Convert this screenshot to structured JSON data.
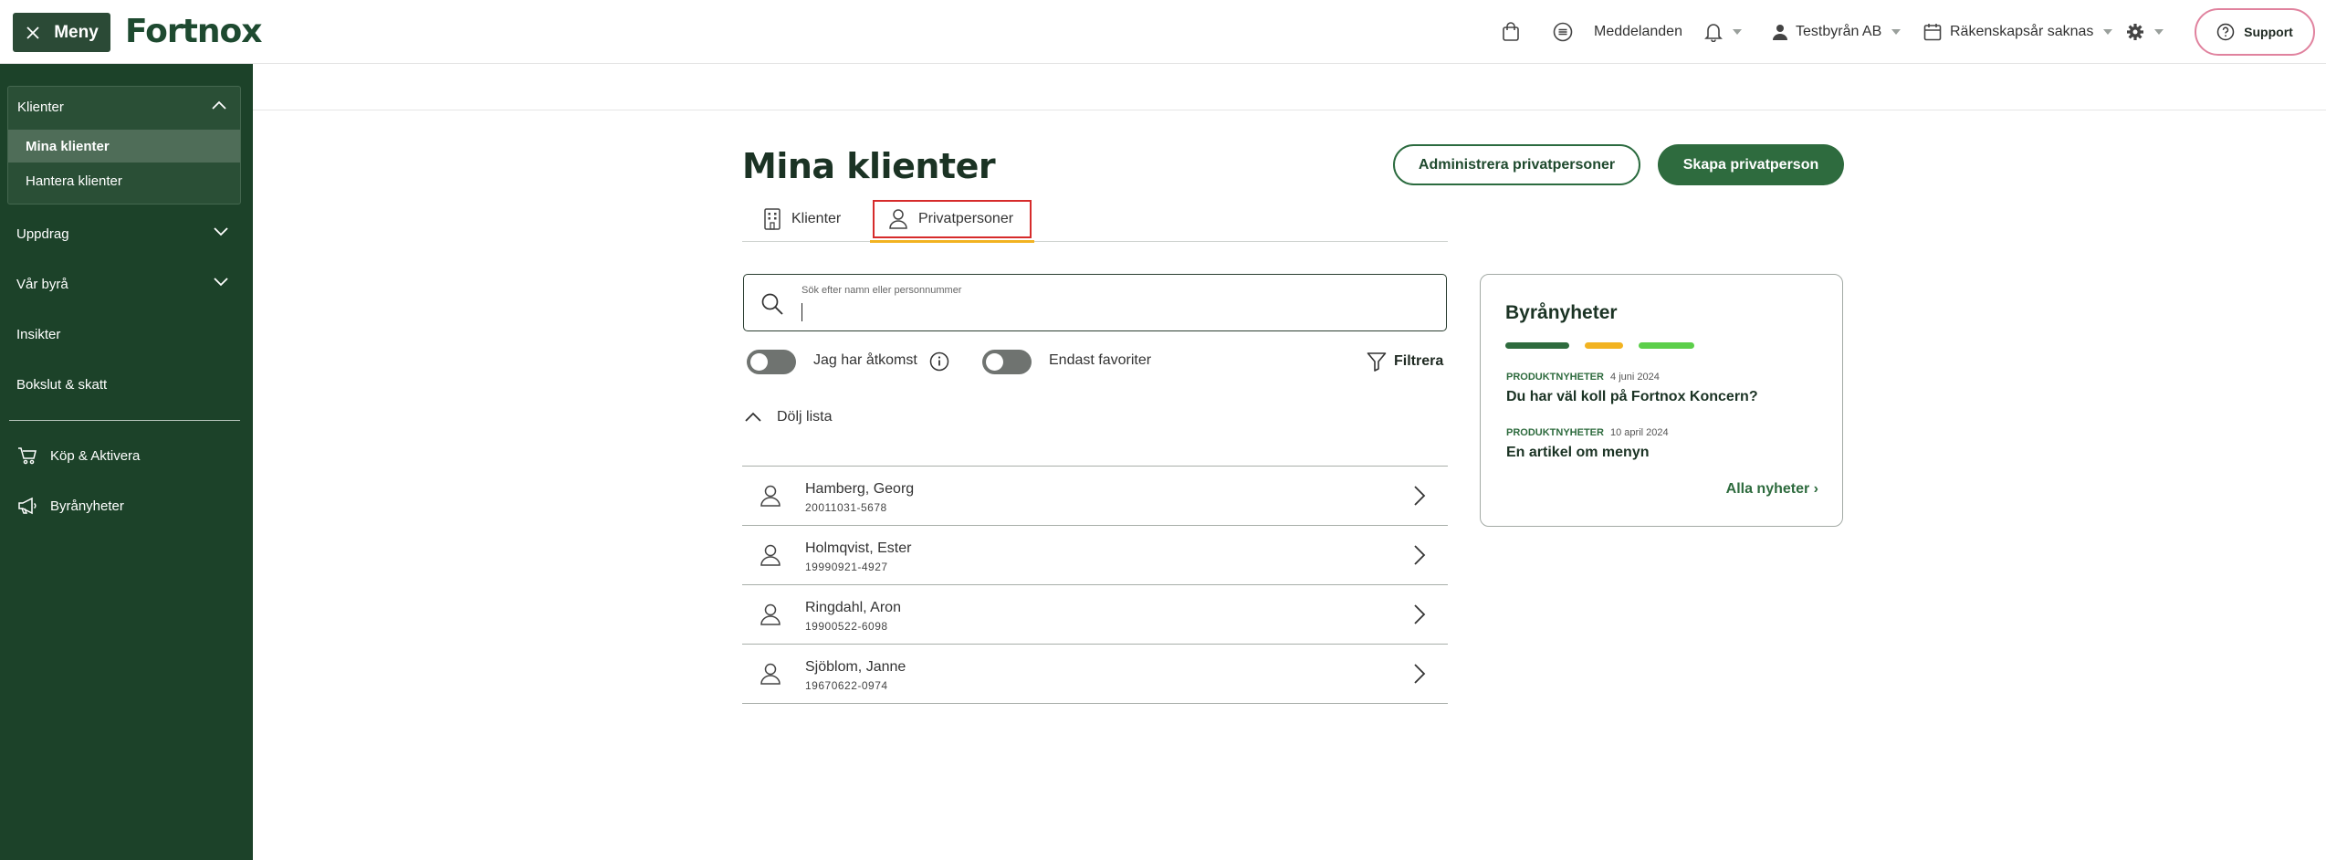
{
  "header": {
    "menu_label": "Meny",
    "logo": "Fortnox",
    "messages": "Meddelanden",
    "company": "Testbyrån AB",
    "fiscal_year": "Räkenskapsår saknas",
    "support": "Support"
  },
  "sidebar": {
    "group_title": "Klienter",
    "group_items": [
      "Mina klienter",
      "Hantera klienter"
    ],
    "items": [
      "Uppdrag",
      "Vår byrå",
      "Insikter",
      "Bokslut & skatt"
    ],
    "bottom_items": [
      "Köp & Aktivera",
      "Byrånyheter"
    ]
  },
  "main": {
    "title": "Mina klienter",
    "admin_button": "Administrera privatpersoner",
    "create_button": "Skapa privatperson",
    "tabs": [
      "Klienter",
      "Privatpersoner"
    ],
    "search_placeholder": "Sök efter namn eller personnummer",
    "toggle1_label": "Jag har åtkomst",
    "toggle2_label": "Endast favoriter",
    "filter_label": "Filtrera",
    "hide_list_label": "Dölj lista",
    "clients": [
      {
        "name": "Hamberg, Georg",
        "pnr": "20011031-5678"
      },
      {
        "name": "Holmqvist, Ester",
        "pnr": "19990921-4927"
      },
      {
        "name": "Ringdahl, Aron",
        "pnr": "19900522-6098"
      },
      {
        "name": "Sjöblom, Janne",
        "pnr": "19670622-0974"
      }
    ]
  },
  "news": {
    "title": "Byrånyheter",
    "bar_colors": [
      "#2e6b3e",
      "#f2b321",
      "#5ccf4a"
    ],
    "items": [
      {
        "tag": "PRODUKTNYHETER",
        "date": "4 juni 2024",
        "title": "Du har väl koll på Fortnox Koncern?"
      },
      {
        "tag": "PRODUKTNYHETER",
        "date": "10 april 2024",
        "title": "En artikel om menyn"
      }
    ],
    "all_link": "Alla nyheter ›"
  }
}
